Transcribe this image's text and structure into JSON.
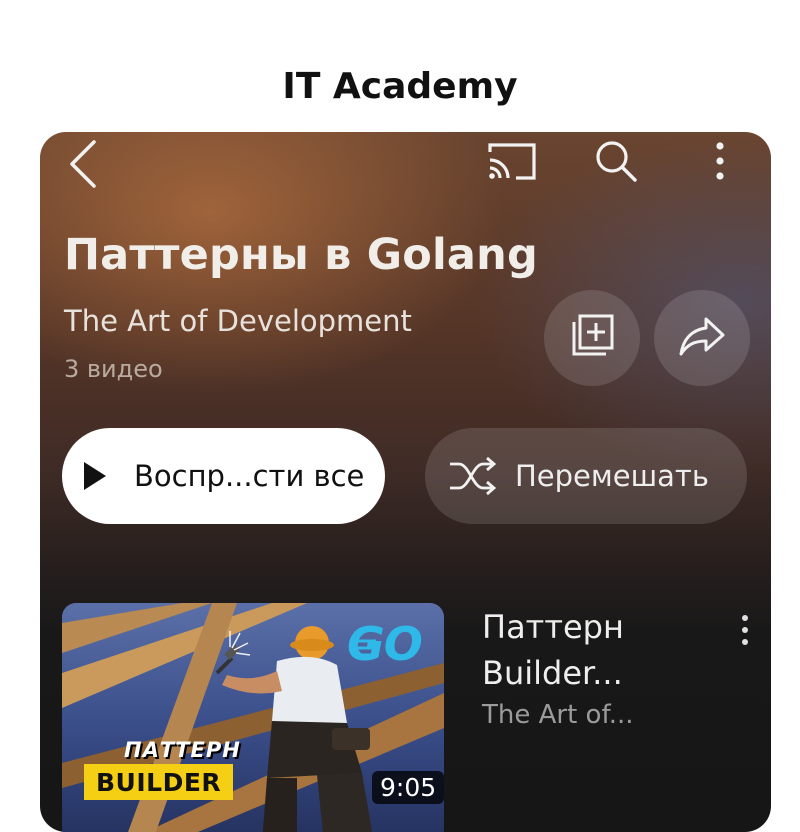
{
  "page_title": "IT Academy",
  "header": {
    "icons": [
      "back-icon",
      "cast-icon",
      "search-icon",
      "more-icon"
    ]
  },
  "playlist": {
    "title": "Паттерны в Golang",
    "channel": "The Art of Development",
    "video_count": "3 видео",
    "actions": [
      "save-to-library-icon",
      "share-icon"
    ]
  },
  "buttons": {
    "play_all": "Воспр...сти все",
    "shuffle": "Перемешать"
  },
  "videos": [
    {
      "title": "Паттерн Builder...",
      "title_line1": "Паттерн",
      "title_line2": "Builder...",
      "channel": "The Art of...",
      "duration": "9:05",
      "thumbnail_text": {
        "logo": "GO",
        "line1": "ПАТТЕРН",
        "line2": "BUILDER"
      }
    }
  ],
  "colors": {
    "thumbnail_badge": "#f5cf14",
    "go_logo": "#2fb9e8",
    "background_dark": "#161616"
  }
}
